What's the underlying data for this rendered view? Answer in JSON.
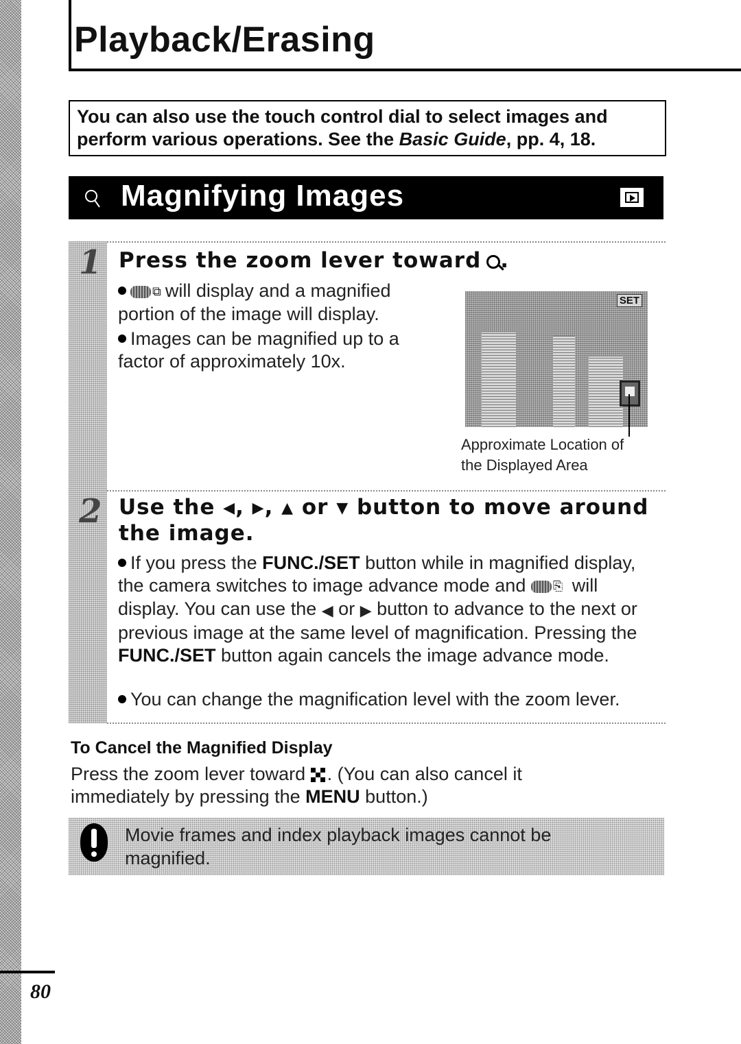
{
  "page": {
    "title": "Playback/Erasing",
    "page_number": "80"
  },
  "intro": {
    "text_before": "You can also use the touch control dial to select images and perform various operations. See the ",
    "italic": "Basic Guide",
    "text_after": ", pp. 4, 18."
  },
  "section": {
    "icon": "magnify-icon",
    "title": "Magnifying Images",
    "mode_icon": "playback-mode-icon"
  },
  "step1": {
    "number": "1",
    "heading": "Press the zoom lever toward",
    "heading_suffix": ".",
    "bullets": [
      {
        "icons": [
          "set-badge-icon",
          "magnify-position-icon"
        ],
        "text": "will display and a magnified portion of the image will display."
      },
      {
        "text": "Images can be magnified up to a factor of approximately 10x."
      }
    ],
    "photo_overlay_label": "SET",
    "caption_line1": "Approximate Location of",
    "caption_line2": "the Displayed Area"
  },
  "step2": {
    "number": "2",
    "heading_prefix": "Use the",
    "arrows": [
      "◆",
      "◆",
      "▲",
      "▼"
    ],
    "arrow_names": [
      "left",
      "right",
      "up",
      "down"
    ],
    "heading_or": "or",
    "heading_suffix": "button to move around the image.",
    "bullet1": {
      "part1": "If you press the ",
      "bold1": "FUNC./SET",
      "part2": " button while in magnified display, the camera switches to image advance mode and ",
      "part3": " will display. You can use the ",
      "or": "or",
      "part4": " button to advance to the next or previous image at the same level of magnification. Pressing the ",
      "bold2": "FUNC./SET",
      "part5": " button again cancels the image advance mode."
    },
    "bullet2": "You can change the magnification level with the zoom lever."
  },
  "cancel": {
    "heading": "To Cancel the Magnified Display",
    "text1": "Press the zoom lever toward ",
    "text2": ". (You can also cancel it immediately by pressing the ",
    "bold": "MENU",
    "text3": " button.)"
  },
  "note": {
    "icon": "caution-icon",
    "text": "Movie frames and index playback images cannot be magnified."
  }
}
